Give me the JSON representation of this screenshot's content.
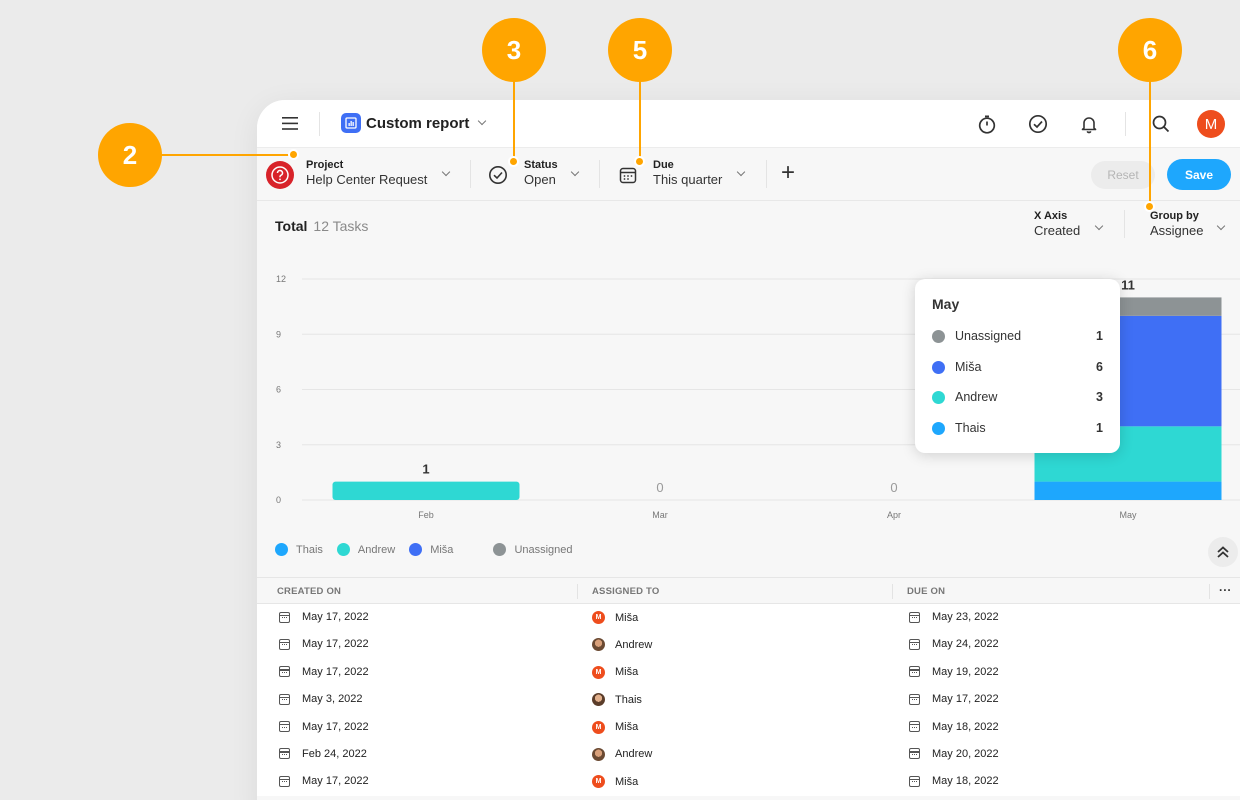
{
  "header": {
    "report_title": "Custom report",
    "avatar_initial": "M"
  },
  "filters": {
    "project": {
      "label": "Project",
      "value": "Help Center Request"
    },
    "status": {
      "label": "Status",
      "value": "Open"
    },
    "due": {
      "label": "Due",
      "value": "This quarter"
    },
    "add_label": "+"
  },
  "actions": {
    "reset_label": "Reset",
    "save_label": "Save"
  },
  "summary": {
    "total_label": "Total",
    "count_label": "12 Tasks"
  },
  "axis_controls": {
    "x_axis": {
      "label": "X Axis",
      "value": "Created"
    },
    "group_by": {
      "label": "Group by",
      "value": "Assignee"
    }
  },
  "chart_data": {
    "type": "bar",
    "stacked": true,
    "categories": [
      "Feb",
      "Mar",
      "Apr",
      "May"
    ],
    "series": [
      {
        "name": "Thais",
        "color": "#1ea7fd",
        "values": [
          0,
          0,
          0,
          1
        ]
      },
      {
        "name": "Andrew",
        "color": "#2ed8d3",
        "values": [
          1,
          0,
          0,
          3
        ]
      },
      {
        "name": "Miša",
        "color": "#3f6ff5",
        "values": [
          0,
          0,
          0,
          6
        ]
      },
      {
        "name": "Unassigned",
        "color": "#8d9395",
        "values": [
          0,
          0,
          0,
          1
        ]
      }
    ],
    "totals": [
      1,
      0,
      0,
      11
    ],
    "y_ticks": [
      0,
      3,
      6,
      9,
      12
    ],
    "ylim": [
      0,
      12
    ],
    "grid": true
  },
  "legend": [
    {
      "name": "Thais",
      "color": "#1ea7fd"
    },
    {
      "name": "Andrew",
      "color": "#2ed8d3"
    },
    {
      "name": "Miša",
      "color": "#3f6ff5"
    },
    {
      "name": "Unassigned",
      "color": "#8d9395"
    }
  ],
  "tooltip": {
    "title": "May",
    "rows": [
      {
        "name": "Unassigned",
        "value": "1",
        "color": "#8d9395"
      },
      {
        "name": "Miša",
        "value": "6",
        "color": "#3f6ff5"
      },
      {
        "name": "Andrew",
        "value": "3",
        "color": "#2ed8d3"
      },
      {
        "name": "Thais",
        "value": "1",
        "color": "#1ea7fd"
      }
    ]
  },
  "table": {
    "columns": [
      "CREATED ON",
      "ASSIGNED TO",
      "DUE ON"
    ],
    "more_label": "···",
    "rows": [
      {
        "created": "May 17, 2022",
        "assignee": "Miša",
        "avatar": "m",
        "due": "May 23, 2022"
      },
      {
        "created": "May 17, 2022",
        "assignee": "Andrew",
        "avatar": "a",
        "due": "May 24, 2022"
      },
      {
        "created": "May 17, 2022",
        "assignee": "Miša",
        "avatar": "m",
        "due": "May 19, 2022"
      },
      {
        "created": "May 3, 2022",
        "assignee": "Thais",
        "avatar": "t",
        "due": "May 17, 2022"
      },
      {
        "created": "May 17, 2022",
        "assignee": "Miša",
        "avatar": "m",
        "due": "May 18, 2022"
      },
      {
        "created": "Feb 24, 2022",
        "assignee": "Andrew",
        "avatar": "a",
        "due": "May 20, 2022"
      },
      {
        "created": "May 17, 2022",
        "assignee": "Miša",
        "avatar": "m",
        "due": "May 18, 2022"
      }
    ]
  },
  "callouts": [
    "2",
    "3",
    "5",
    "6"
  ]
}
